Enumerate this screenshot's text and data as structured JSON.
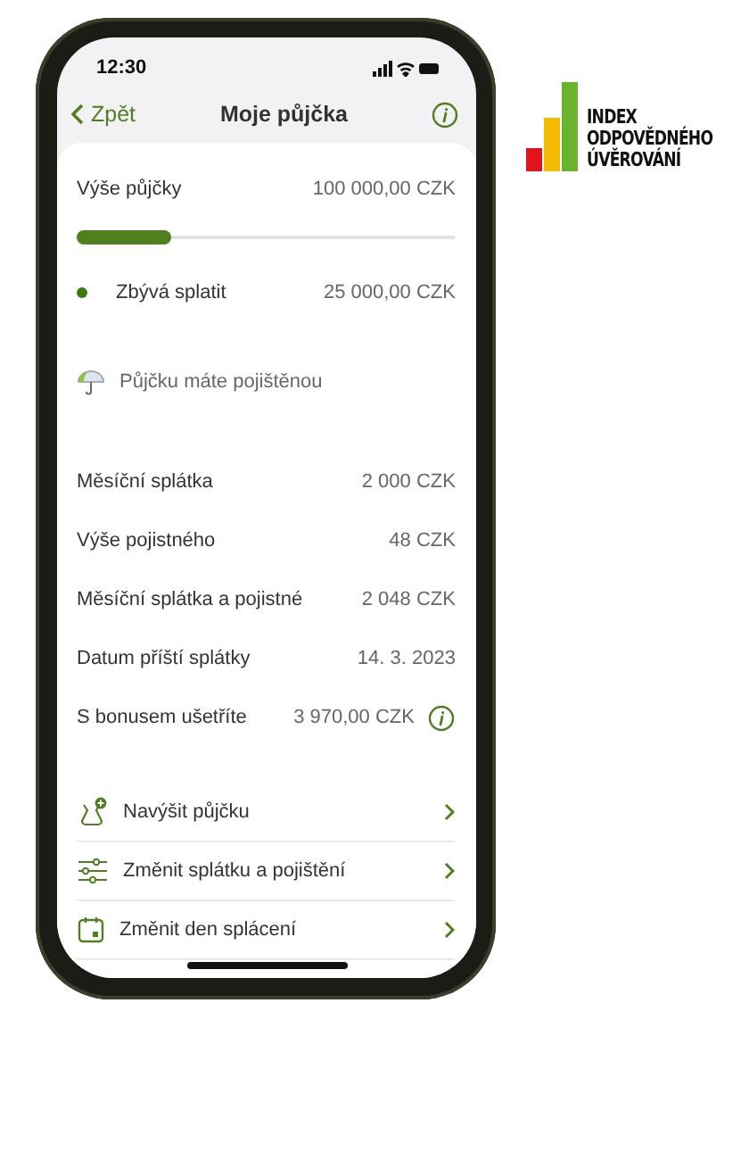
{
  "status_bar": {
    "time": "12:30"
  },
  "nav": {
    "back": "Zpět",
    "title": "Moje půjčka"
  },
  "loan": {
    "label": "Výše půjčky",
    "value": "100 000,00 CZK"
  },
  "progress": {
    "level": 0.25
  },
  "remaining": {
    "label": "Zbývá splatit",
    "value": "25 000,00 CZK"
  },
  "insurance": {
    "text": "Půjčku máte pojištěnou"
  },
  "details": [
    {
      "label": "Měsíční splátka",
      "value": "2 000 CZK",
      "info": false
    },
    {
      "label": "Výše pojistného",
      "value": "48 CZK",
      "info": false
    },
    {
      "label": "Měsíční splátka a pojistné",
      "value": "2 048 CZK",
      "info": false
    },
    {
      "label": "Datum příští splátky",
      "value": "14. 3. 2023",
      "info": false
    },
    {
      "label": "S bonusem ušetříte",
      "value": "3 970,00 CZK",
      "info": true
    }
  ],
  "actions": [
    {
      "kind": "increase",
      "label": "Navýšit půjčku"
    },
    {
      "kind": "sliders",
      "label": "Změnit splátku a pojištění"
    },
    {
      "kind": "calendar",
      "label": "Změnit den splácení"
    }
  ],
  "logo": {
    "lines": [
      "INDEX",
      "ODPOVĚDNÉHO",
      "ÚVĚROVÁNÍ"
    ]
  }
}
